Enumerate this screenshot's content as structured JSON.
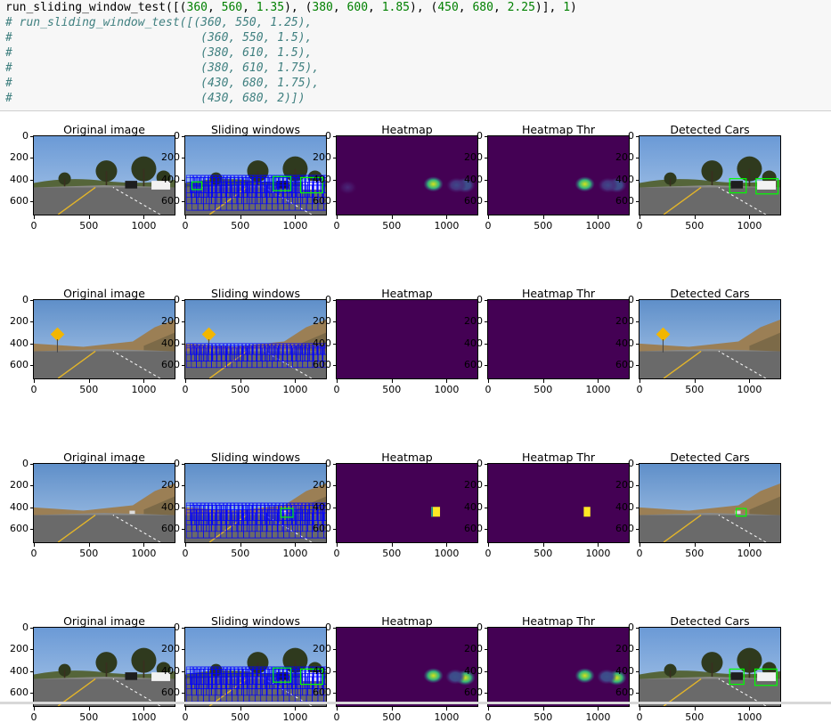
{
  "code_cell": {
    "lines": [
      {
        "text": "run_sliding_window_test([(360, 560, 1.35), (380, 600, 1.85), (450, 680, 2.25)], 1)",
        "type": "code"
      },
      {
        "text": "# run_sliding_window_test([(360, 550, 1.25),",
        "type": "comment"
      },
      {
        "text": "#                           (360, 550, 1.5),",
        "type": "comment"
      },
      {
        "text": "#                           (380, 610, 1.5),",
        "type": "comment"
      },
      {
        "text": "#                           (380, 610, 1.75),",
        "type": "comment"
      },
      {
        "text": "#                           (430, 680, 1.75),",
        "type": "comment"
      },
      {
        "text": "#                           (430, 680, 2)])",
        "type": "comment"
      }
    ]
  },
  "panel_titles": [
    "Original image",
    "Sliding windows",
    "Heatmap",
    "Heatmap Thr",
    "Detected Cars"
  ],
  "y_ticks": [
    "0",
    "200",
    "400",
    "600"
  ],
  "x_ticks": [
    "0",
    "500",
    "1000"
  ],
  "colors": {
    "heatmap_bg": "#440154",
    "window_blue": "#0000ff",
    "detect_green": "#00ff00",
    "code_bg": "#f7f7f7",
    "comment": "#408080",
    "number": "#008000"
  },
  "rows": [
    {
      "scene": "trees_cars",
      "heat_blobs": [
        {
          "x": 880,
          "y": 440,
          "kind": "bright"
        },
        {
          "x": 1170,
          "y": 450,
          "kind": "mid"
        },
        {
          "x": 1090,
          "y": 450,
          "kind": "dim"
        },
        {
          "x": 100,
          "y": 470,
          "kind": "faint"
        }
      ],
      "thr_blobs": [
        {
          "x": 880,
          "y": 440,
          "kind": "bright"
        },
        {
          "x": 1170,
          "y": 450,
          "kind": "mid"
        },
        {
          "x": 1090,
          "y": 450,
          "kind": "dim"
        }
      ]
    },
    {
      "scene": "hills_sign",
      "heat_blobs": [],
      "thr_blobs": []
    },
    {
      "scene": "hills_far_car",
      "heat_blobs": [
        {
          "x": 900,
          "y": 440,
          "kind": "yellow_rect"
        }
      ],
      "thr_blobs": [
        {
          "x": 900,
          "y": 440,
          "kind": "yellow_rect_small"
        }
      ]
    },
    {
      "scene": "trees_cars_2",
      "heat_blobs": [
        {
          "x": 880,
          "y": 440,
          "kind": "bright"
        },
        {
          "x": 1170,
          "y": 460,
          "kind": "bright"
        },
        {
          "x": 1080,
          "y": 450,
          "kind": "mid"
        }
      ],
      "thr_blobs": [
        {
          "x": 880,
          "y": 440,
          "kind": "bright"
        },
        {
          "x": 1170,
          "y": 460,
          "kind": "bright"
        },
        {
          "x": 1080,
          "y": 450,
          "kind": "mid"
        }
      ]
    }
  ]
}
